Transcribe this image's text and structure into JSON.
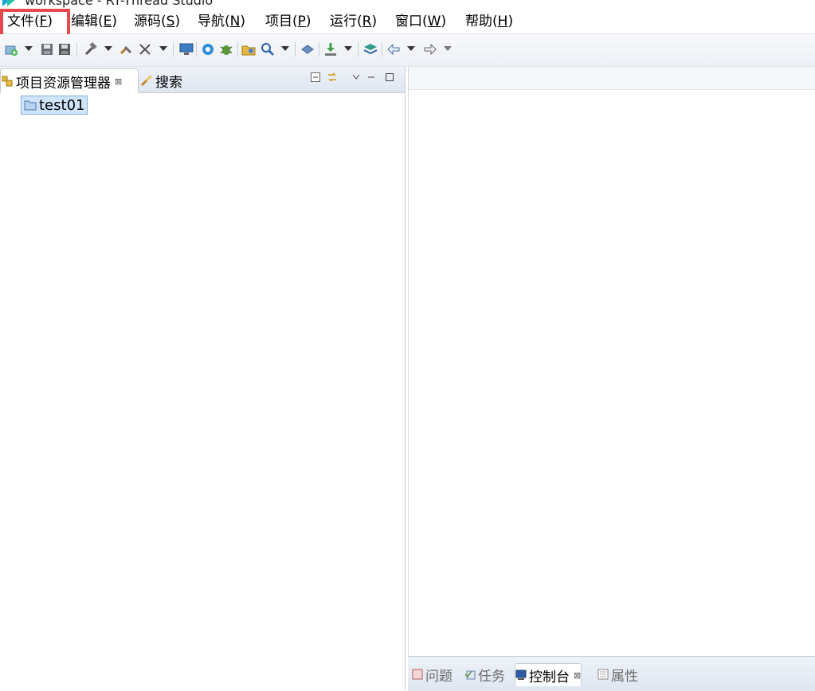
{
  "window": {
    "title": "workspace - RT-Thread Studio"
  },
  "menu": {
    "items": [
      {
        "label": "文件(",
        "mnemonic": "F",
        "close": ")"
      },
      {
        "label": "编辑(",
        "mnemonic": "E",
        "close": ")"
      },
      {
        "label": "源码(",
        "mnemonic": "S",
        "close": ")"
      },
      {
        "label": "导航(",
        "mnemonic": "N",
        "close": ")"
      },
      {
        "label": "项目(",
        "mnemonic": "P",
        "close": ")"
      },
      {
        "label": "运行(",
        "mnemonic": "R",
        "close": ")"
      },
      {
        "label": "窗口(",
        "mnemonic": "W",
        "close": ")"
      },
      {
        "label": "帮助(",
        "mnemonic": "H",
        "close": ")"
      }
    ],
    "highlight_color": "#e8474d"
  },
  "toolbar": {
    "icons": [
      "new-icon",
      "save-icon",
      "save-all-icon",
      "build-icon",
      "clean-icon",
      "tools-icon",
      "monitor-icon",
      "settings-icon",
      "debug-bug-icon",
      "open-folder-icon",
      "search-icon",
      "book-icon",
      "download-icon",
      "layers-icon",
      "back-arrow-icon",
      "forward-arrow-icon"
    ]
  },
  "left_panel": {
    "tabs": [
      {
        "label": "项目资源管理器",
        "close": "⊠"
      },
      {
        "label": "搜索"
      }
    ],
    "tree": [
      {
        "label": "test01"
      }
    ]
  },
  "bottom_panel": {
    "tabs": [
      {
        "label": "问题"
      },
      {
        "label": "任务"
      },
      {
        "label": "控制台",
        "close": "⊠"
      },
      {
        "label": "属性"
      }
    ]
  },
  "colors": {
    "selection_bg": "#cfe4fa",
    "selection_border": "#7fb1e6",
    "tab_bg": "#dfe6f0"
  }
}
